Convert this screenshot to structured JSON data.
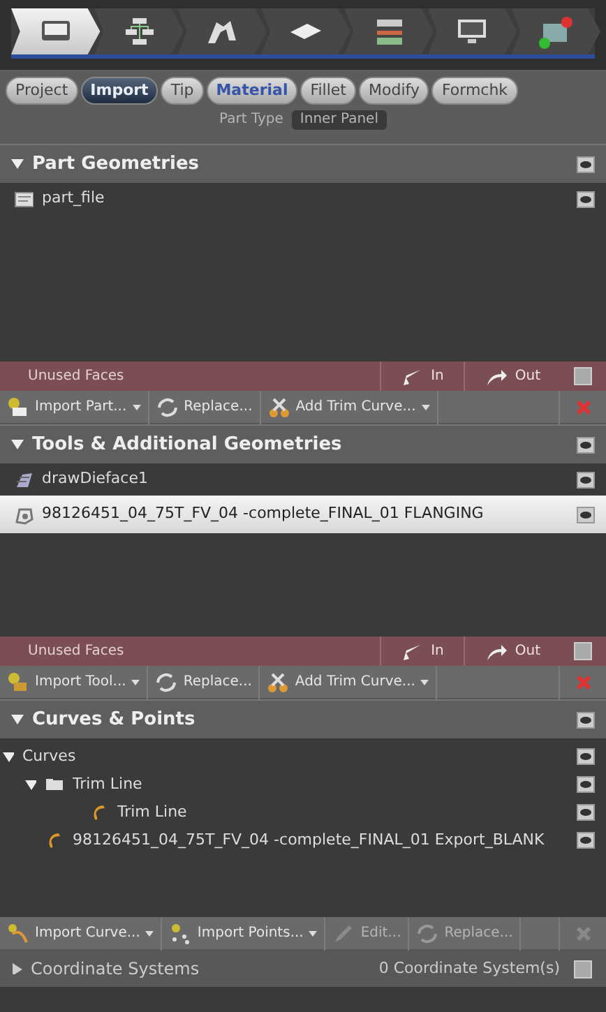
{
  "steps": [
    {
      "selected": true
    },
    {
      "selected": false
    },
    {
      "selected": false
    },
    {
      "selected": false
    },
    {
      "selected": false
    },
    {
      "selected": false
    },
    {
      "selected": false
    }
  ],
  "tabs": [
    {
      "label": "Project",
      "selected": false,
      "highlighted": false
    },
    {
      "label": "Import",
      "selected": true,
      "highlighted": false
    },
    {
      "label": "Tip",
      "selected": false,
      "highlighted": false
    },
    {
      "label": "Material",
      "selected": false,
      "highlighted": true
    },
    {
      "label": "Fillet",
      "selected": false,
      "highlighted": false
    },
    {
      "label": "Modify",
      "selected": false,
      "highlighted": false
    },
    {
      "label": "Formchk",
      "selected": false,
      "highlighted": false
    }
  ],
  "part_type": {
    "label": "Part Type",
    "value": "Inner Panel"
  },
  "sections": [
    {
      "title": "Part Geometries",
      "expanded": true,
      "items": [
        {
          "label": "part_file",
          "selected": false,
          "kind": "part"
        }
      ],
      "unused_faces": {
        "label": "Unused Faces",
        "in": "In",
        "out": "Out",
        "checked": false
      },
      "toolbar": [
        {
          "label": "Import Part...",
          "dropdown": true,
          "disabled": false,
          "kind": "import-part"
        },
        {
          "label": "Replace...",
          "dropdown": false,
          "disabled": false,
          "kind": "replace"
        },
        {
          "label": "Add Trim Curve...",
          "dropdown": true,
          "disabled": false,
          "kind": "trim"
        },
        {
          "kind": "delete",
          "disabled": false
        }
      ]
    },
    {
      "title": "Tools & Additional Geometries",
      "expanded": true,
      "items": [
        {
          "label": "drawDieface1",
          "selected": false,
          "kind": "dieface"
        },
        {
          "label": "98126451_04_75T_FV_04 -complete_FINAL_01 FLANGING",
          "selected": true,
          "kind": "tool"
        }
      ],
      "unused_faces": {
        "label": "Unused Faces",
        "in": "In",
        "out": "Out",
        "checked": false
      },
      "toolbar": [
        {
          "label": "Import Tool...",
          "dropdown": true,
          "disabled": false,
          "kind": "import-tool"
        },
        {
          "label": "Replace...",
          "dropdown": false,
          "disabled": false,
          "kind": "replace"
        },
        {
          "label": "Add Trim Curve...",
          "dropdown": true,
          "disabled": false,
          "kind": "trim"
        },
        {
          "kind": "delete",
          "disabled": false
        }
      ]
    },
    {
      "title": "Curves & Points",
      "expanded": true,
      "tree": [
        {
          "label": "Curves",
          "expanded": true,
          "children": [
            {
              "label": "Trim Line",
              "expanded": true,
              "kind": "folder",
              "children": [
                {
                  "label": "Trim Line",
                  "kind": "curve"
                }
              ]
            },
            {
              "label": "98126451_04_75T_FV_04 -complete_FINAL_01 Export_BLANK",
              "kind": "curve"
            }
          ]
        }
      ],
      "toolbar": [
        {
          "label": "Import Curve...",
          "dropdown": true,
          "disabled": false,
          "kind": "import-curve"
        },
        {
          "label": "Import Points...",
          "dropdown": true,
          "disabled": false,
          "kind": "import-points"
        },
        {
          "label": "Edit...",
          "dropdown": false,
          "disabled": true,
          "kind": "edit"
        },
        {
          "label": "Replace...",
          "dropdown": false,
          "disabled": true,
          "kind": "replace"
        },
        {
          "kind": "delete",
          "disabled": true
        }
      ]
    }
  ],
  "coordinate_systems": {
    "title": "Coordinate Systems",
    "expanded": false,
    "count": "0 Coordinate System(s)",
    "checked": false
  }
}
